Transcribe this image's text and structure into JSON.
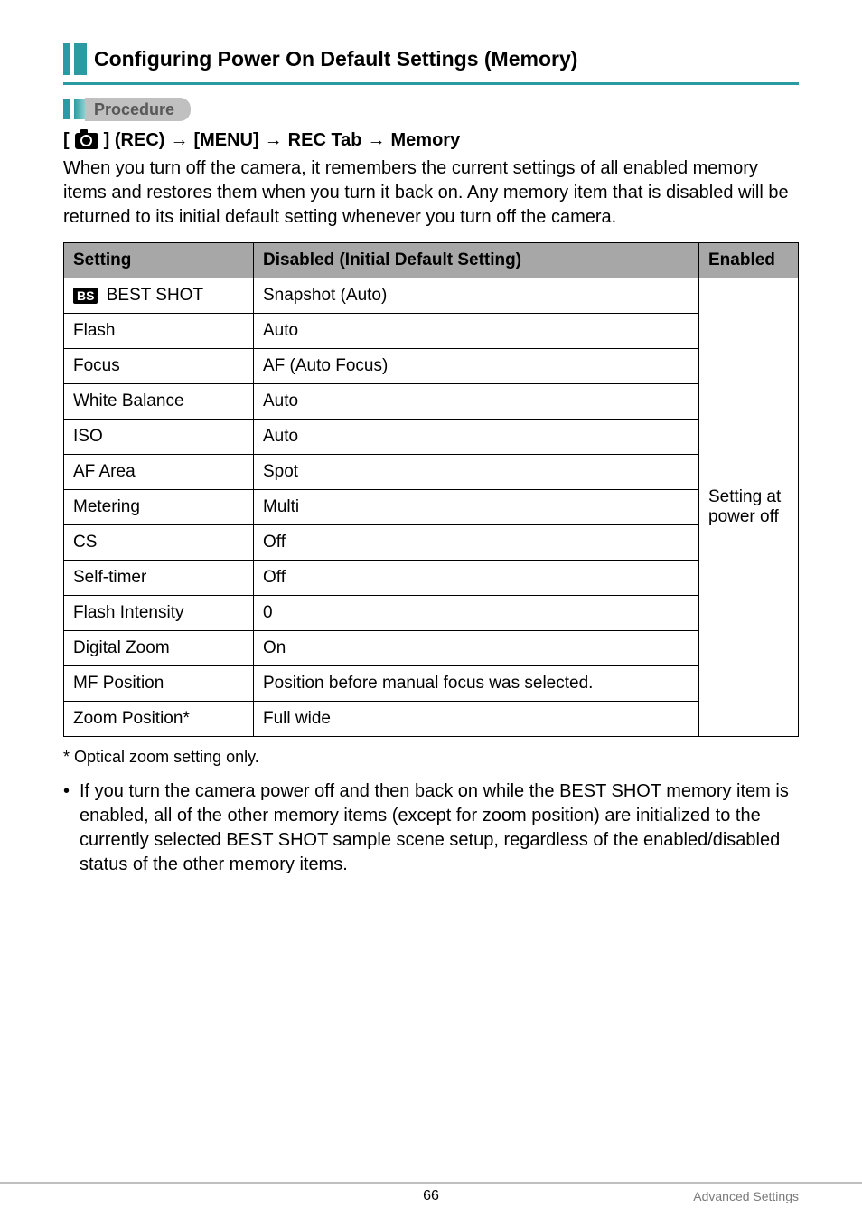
{
  "header": {
    "title": "Configuring Power On Default Settings (Memory)"
  },
  "procedure": {
    "label": "Procedure",
    "path": {
      "seg1_open": "[",
      "seg1_close": "] (REC)",
      "seg2": "[MENU]",
      "seg3": "REC Tab",
      "seg4": "Memory"
    }
  },
  "intro": "When you turn off the camera, it remembers the current settings of all enabled memory items and restores them when you turn it back on. Any memory item that is disabled will be returned to its initial default setting whenever you turn off the camera.",
  "table": {
    "headers": {
      "setting": "Setting",
      "disabled": "Disabled (Initial Default Setting)",
      "enabled": "Enabled"
    },
    "rows": [
      {
        "setting_icon": "BS",
        "setting": "BEST SHOT",
        "disabled": "Snapshot (Auto)"
      },
      {
        "setting": "Flash",
        "disabled": "Auto"
      },
      {
        "setting": "Focus",
        "disabled": "AF (Auto Focus)"
      },
      {
        "setting": "White Balance",
        "disabled": "Auto"
      },
      {
        "setting": "ISO",
        "disabled": "Auto"
      },
      {
        "setting": "AF Area",
        "disabled": "Spot"
      },
      {
        "setting": "Metering",
        "disabled": "Multi"
      },
      {
        "setting": "CS",
        "disabled": "Off"
      },
      {
        "setting": "Self-timer",
        "disabled": "Off"
      },
      {
        "setting": "Flash Intensity",
        "disabled": "0"
      },
      {
        "setting": "Digital Zoom",
        "disabled": "On"
      },
      {
        "setting": "MF Position",
        "disabled": "Position before manual focus was selected."
      },
      {
        "setting": "Zoom Position*",
        "disabled": "Full wide"
      }
    ],
    "enabled_text": "Setting at power off"
  },
  "footnote": "Optical zoom setting only.",
  "footnote_marker": "*",
  "bullet": "If you turn the camera power off and then back on while the BEST SHOT memory item is enabled, all of the other memory items (except for zoom position) are initialized to the currently selected BEST SHOT sample scene setup, regardless of the enabled/disabled status of the other memory items.",
  "footer": {
    "page": "66",
    "section": "Advanced Settings"
  }
}
